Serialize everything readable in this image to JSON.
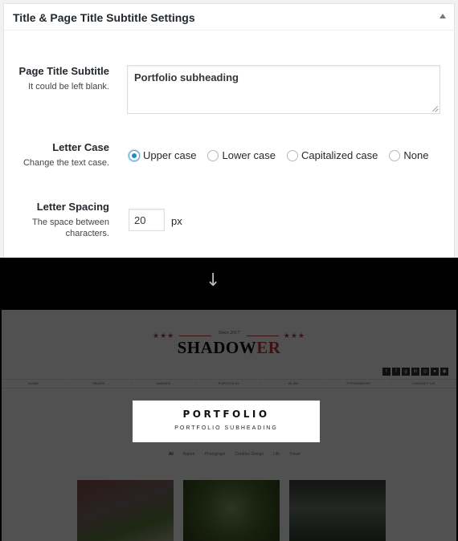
{
  "panel": {
    "title": "Title & Page Title Subtitle Settings",
    "subtitle_field": {
      "label": "Page Title Subtitle",
      "description": "It could be left blank.",
      "value": "Portfolio subheading"
    },
    "letter_case": {
      "label": "Letter Case",
      "description": "Change the text case.",
      "options": [
        "Upper case",
        "Lower case",
        "Capitalized case",
        "None"
      ],
      "selected": "Upper case"
    },
    "letter_spacing": {
      "label": "Letter Spacing",
      "description_line1": "The space between",
      "description_line2": "characters.",
      "value": "20",
      "unit": "px"
    }
  },
  "divider": {
    "arrow": "↓"
  },
  "preview": {
    "logo": {
      "stars": "★★★",
      "since": "Since 2017",
      "name_main": "SHADOW",
      "name_accent": "ER"
    },
    "social_icons": [
      "twitter-icon",
      "facebook-icon",
      "google-plus-icon",
      "linkedin-icon",
      "instagram-icon",
      "dribbble-icon",
      "rss-icon"
    ],
    "nav": [
      "HOME",
      "PAGES",
      "IMAGES",
      "PORTFOLIO",
      "BLOG",
      "TYPOGRAPHY",
      "CONTACT US"
    ],
    "hero": {
      "title": "PORTFOLIO",
      "subtitle": "PORTFOLIO SUBHEADING"
    },
    "filters": [
      "All",
      "Nature",
      "Photograph",
      "Creative Design",
      "Life",
      "Travel"
    ],
    "colors": {
      "accent": "#c0393b",
      "radio": "#1e8cbe"
    }
  }
}
